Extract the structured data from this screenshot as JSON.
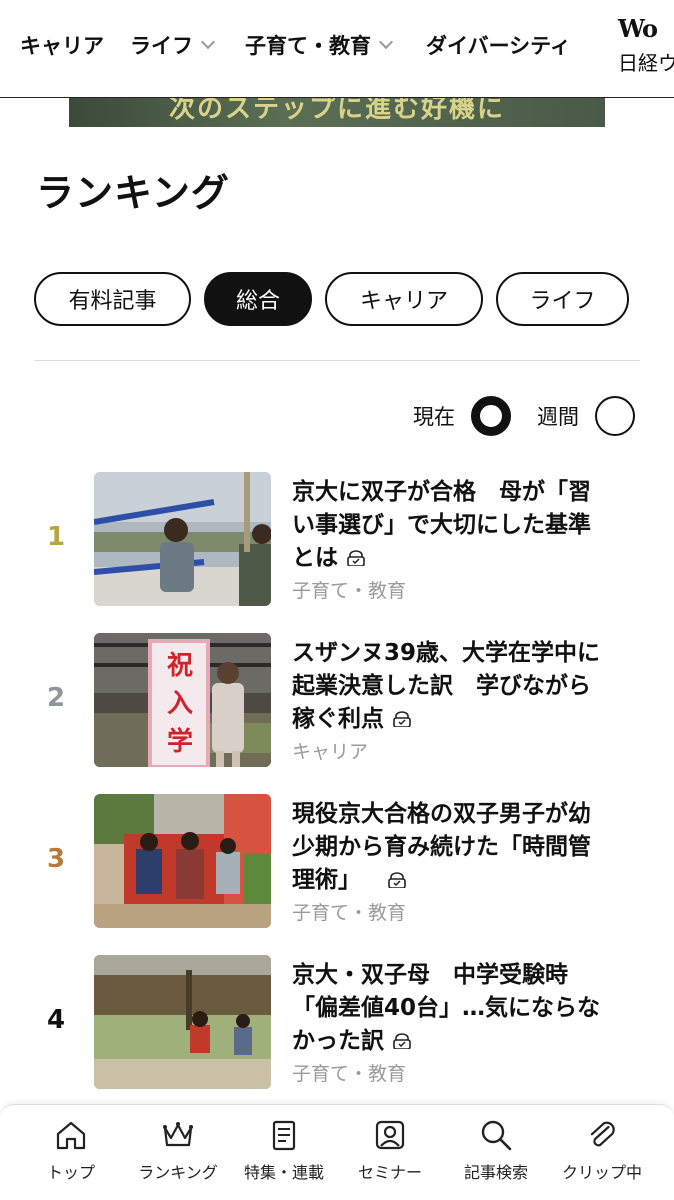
{
  "nav": {
    "items": [
      {
        "label": "キャリア",
        "has_dropdown": false
      },
      {
        "label": "ライフ",
        "has_dropdown": true
      },
      {
        "label": "子育て・教育",
        "has_dropdown": true
      },
      {
        "label": "ダイバーシティ",
        "has_dropdown": false
      }
    ],
    "brand_logo": "Wo",
    "brand_sub": "日経ウ"
  },
  "banner": {
    "text": "次のステップに進む好機に"
  },
  "page_title": "ランキング",
  "filters": [
    {
      "label": "有料記事",
      "active": false
    },
    {
      "label": "総合",
      "active": true
    },
    {
      "label": "キャリア",
      "active": false
    },
    {
      "label": "ライフ",
      "active": false
    }
  ],
  "period": {
    "current_label": "現在",
    "weekly_label": "週間",
    "selected": "現在"
  },
  "rankings": [
    {
      "rank": "1",
      "rank_color": "#b5a642",
      "title_lines": [
        "京大に双子が合格　母が「習",
        "い事選び」で大切にした基準",
        "とは"
      ],
      "locked": true,
      "category": "子育て・教育",
      "thumb_icon": "kids-playing-photo"
    },
    {
      "rank": "2",
      "rank_color": "#8c969c",
      "title_lines": [
        "スザンヌ39歳、大学在学中に",
        "起業決意した訳　学びながら",
        "稼ぐ利点"
      ],
      "locked": true,
      "category": "キャリア",
      "thumb_icon": "entrance-ceremony-photo",
      "thumb_sign": [
        "祝",
        "入",
        "学"
      ]
    },
    {
      "rank": "3",
      "rank_color": "#b8793a",
      "title_lines": [
        "現役京大合格の双子男子が幼",
        "少期から育み続けた「時間管",
        "理術」"
      ],
      "locked": true,
      "category": "子育て・教育",
      "thumb_icon": "children-wall-photo"
    },
    {
      "rank": "4",
      "rank_color": "#111111",
      "title_lines": [
        "京大・双子母　中学受験時",
        "「偏差値40台」…気にならな",
        "かった訳"
      ],
      "locked": true,
      "category": "子育て・教育",
      "thumb_icon": "kids-park-photo"
    }
  ],
  "tabbar": [
    {
      "label": "トップ",
      "icon": "home-icon"
    },
    {
      "label": "ランキング",
      "icon": "crown-icon"
    },
    {
      "label": "特集・連載",
      "icon": "document-icon"
    },
    {
      "label": "セミナー",
      "icon": "seminar-icon"
    },
    {
      "label": "記事検索",
      "icon": "search-icon"
    },
    {
      "label": "クリップ中",
      "icon": "paperclip-icon"
    }
  ]
}
